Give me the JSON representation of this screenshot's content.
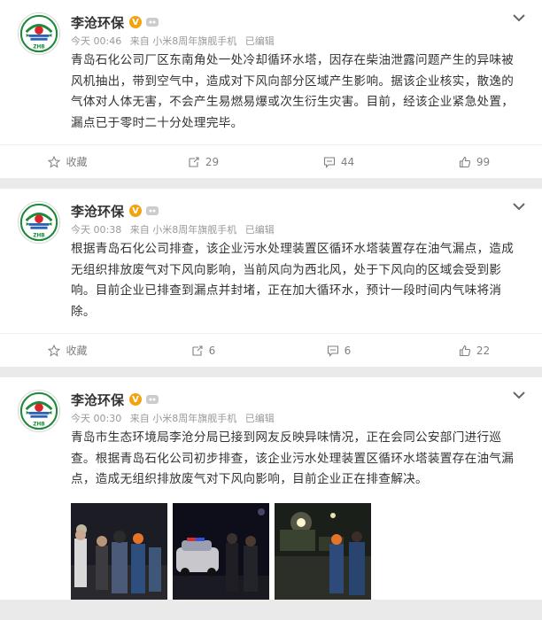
{
  "posts": [
    {
      "author": "李沧环保",
      "verified_badge": "V",
      "time": "今天 00:46",
      "source": "来自 小米8周年旗舰手机",
      "edited": "已编辑",
      "text": "青岛石化公司厂区东南角处一处冷却循环水塔，因存在柴油泄露问题产生的异味被风机抽出，带到空气中，造成对下风向部分区域产生影响。据该企业核实，散逸的气体对人体无害，不会产生易燃易爆或次生衍生灾害。目前，经该企业紧急处置，漏点已于零时二十分处理完毕。",
      "actions": {
        "favorite": "收藏",
        "repost": "29",
        "comment": "44",
        "like": "99"
      }
    },
    {
      "author": "李沧环保",
      "verified_badge": "V",
      "time": "今天 00:38",
      "source": "来自 小米8周年旗舰手机",
      "edited": "已编辑",
      "text": "根据青岛石化公司排查，该企业污水处理装置区循环水塔装置存在油气漏点，造成无组织排放废气对下风向影响，当前风向为西北风，处于下风向的区域会受到影响。目前企业已排查到漏点并封堵，正在加大循环水，预计一段时间内气味将消除。",
      "actions": {
        "favorite": "收藏",
        "repost": "6",
        "comment": "6",
        "like": "22"
      }
    },
    {
      "author": "李沧环保",
      "verified_badge": "V",
      "time": "今天 00:30",
      "source": "来自 小米8周年旗舰手机",
      "edited": "已编辑",
      "text": "青岛市生态环境局李沧分局已接到网友反映异味情况，正在会同公安部门进行巡查。根据青岛石化公司初步排查，该企业污水处理装置区循环水塔装置存在油气漏点，造成无组织排放废气对下风向影响，目前企业正在排查解决。"
    }
  ],
  "avatar_letters": "ZHB",
  "colors": {
    "avatar_green": "#1f8a3a",
    "avatar_red": "#d6262b",
    "avatar_blue": "#2b63b8",
    "badge": "#f3a30e"
  }
}
